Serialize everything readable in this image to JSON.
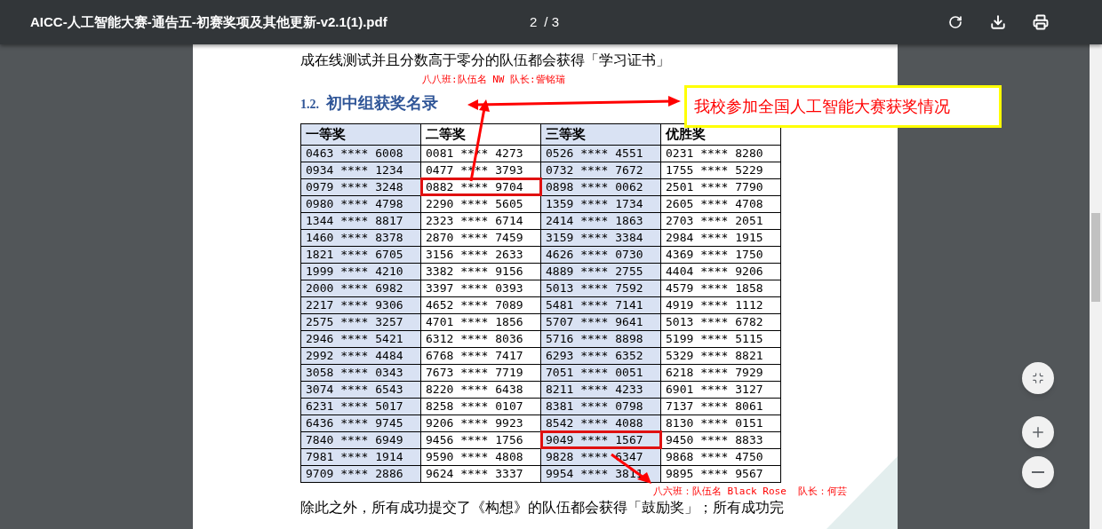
{
  "toolbar": {
    "title": "AICC-人工智能大赛-通告五-初赛奖项及其他更新-v2.1(1).pdf",
    "current_page": "2",
    "page_total": "/ 3"
  },
  "document": {
    "intro_line": "成在线测试并且分数高于零分的队伍都会获得「学习证书」",
    "section_number": "1.2.",
    "section_title": "初中组获奖名录",
    "table": {
      "columns": [
        "一等奖",
        "二等奖",
        "三等奖",
        "优胜奖"
      ],
      "rows": [
        [
          {
            "text": "0463 **** 6008",
            "highlighted": false
          },
          {
            "text": "0081 **** 4273",
            "highlighted": false
          },
          {
            "text": "0526 **** 4551",
            "highlighted": false
          },
          {
            "text": "0231 **** 8280",
            "highlighted": false
          }
        ],
        [
          {
            "text": "0934 **** 1234",
            "highlighted": false
          },
          {
            "text": "0477 **** 3793",
            "highlighted": false
          },
          {
            "text": "0732 **** 7672",
            "highlighted": false
          },
          {
            "text": "1755 **** 5229",
            "highlighted": false
          }
        ],
        [
          {
            "text": "0979 **** 3248",
            "highlighted": false
          },
          {
            "text": "0882 **** 9704",
            "highlighted": true
          },
          {
            "text": "0898 **** 0062",
            "highlighted": false
          },
          {
            "text": "2501 **** 7790",
            "highlighted": false
          }
        ],
        [
          {
            "text": "0980 **** 4798",
            "highlighted": false
          },
          {
            "text": "2290 **** 5605",
            "highlighted": false
          },
          {
            "text": "1359 **** 1734",
            "highlighted": false
          },
          {
            "text": "2605 **** 4708",
            "highlighted": false
          }
        ],
        [
          {
            "text": "1344 **** 8817",
            "highlighted": false
          },
          {
            "text": "2323 **** 6714",
            "highlighted": false
          },
          {
            "text": "2414 **** 1863",
            "highlighted": false
          },
          {
            "text": "2703 **** 2051",
            "highlighted": false
          }
        ],
        [
          {
            "text": "1460 **** 8378",
            "highlighted": false
          },
          {
            "text": "2870 **** 7459",
            "highlighted": false
          },
          {
            "text": "3159 **** 3384",
            "highlighted": false
          },
          {
            "text": "2984 **** 1915",
            "highlighted": false
          }
        ],
        [
          {
            "text": "1821 **** 6705",
            "highlighted": false
          },
          {
            "text": "3156 **** 2633",
            "highlighted": false
          },
          {
            "text": "4626 **** 0730",
            "highlighted": false
          },
          {
            "text": "4369 **** 1750",
            "highlighted": false
          }
        ],
        [
          {
            "text": "1999 **** 4210",
            "highlighted": false
          },
          {
            "text": "3382 **** 9156",
            "highlighted": false
          },
          {
            "text": "4889 **** 2755",
            "highlighted": false
          },
          {
            "text": "4404 **** 9206",
            "highlighted": false
          }
        ],
        [
          {
            "text": "2000 **** 6982",
            "highlighted": false
          },
          {
            "text": "3397 **** 0393",
            "highlighted": false
          },
          {
            "text": "5013 **** 7592",
            "highlighted": false
          },
          {
            "text": "4579 **** 1858",
            "highlighted": false
          }
        ],
        [
          {
            "text": "2217 **** 9306",
            "highlighted": false
          },
          {
            "text": "4652 **** 7089",
            "highlighted": false
          },
          {
            "text": "5481 **** 7141",
            "highlighted": false
          },
          {
            "text": "4919 **** 1112",
            "highlighted": false
          }
        ],
        [
          {
            "text": "2575 **** 3257",
            "highlighted": false
          },
          {
            "text": "4701 **** 1856",
            "highlighted": false
          },
          {
            "text": "5707 **** 9641",
            "highlighted": false
          },
          {
            "text": "5013 **** 6782",
            "highlighted": false
          }
        ],
        [
          {
            "text": "2946 **** 5421",
            "highlighted": false
          },
          {
            "text": "6312 **** 8036",
            "highlighted": false
          },
          {
            "text": "5716 **** 8898",
            "highlighted": false
          },
          {
            "text": "5199 **** 5115",
            "highlighted": false
          }
        ],
        [
          {
            "text": "2992 **** 4484",
            "highlighted": false
          },
          {
            "text": "6768 **** 7417",
            "highlighted": false
          },
          {
            "text": "6293 **** 6352",
            "highlighted": false
          },
          {
            "text": "5329 **** 8821",
            "highlighted": false
          }
        ],
        [
          {
            "text": "3058 **** 0343",
            "highlighted": false
          },
          {
            "text": "7673 **** 7719",
            "highlighted": false
          },
          {
            "text": "7051 **** 0051",
            "highlighted": false
          },
          {
            "text": "6218 **** 7929",
            "highlighted": false
          }
        ],
        [
          {
            "text": "3074 **** 6543",
            "highlighted": false
          },
          {
            "text": "8220 **** 6438",
            "highlighted": false
          },
          {
            "text": "8211 **** 4233",
            "highlighted": false
          },
          {
            "text": "6901 **** 3127",
            "highlighted": false
          }
        ],
        [
          {
            "text": "6231 **** 5017",
            "highlighted": false
          },
          {
            "text": "8258 **** 0107",
            "highlighted": false
          },
          {
            "text": "8381 **** 0798",
            "highlighted": false
          },
          {
            "text": "7137 **** 8061",
            "highlighted": false
          }
        ],
        [
          {
            "text": "6436 **** 9745",
            "highlighted": false
          },
          {
            "text": "9206 **** 9923",
            "highlighted": false
          },
          {
            "text": "8542 **** 4088",
            "highlighted": false
          },
          {
            "text": "8130 **** 0151",
            "highlighted": false
          }
        ],
        [
          {
            "text": "7840 **** 6949",
            "highlighted": false
          },
          {
            "text": "9456 **** 1756",
            "highlighted": false
          },
          {
            "text": "9049 **** 1567",
            "highlighted": true
          },
          {
            "text": "9450 **** 8833",
            "highlighted": false
          }
        ],
        [
          {
            "text": "7981 **** 1914",
            "highlighted": false
          },
          {
            "text": "9590 **** 4808",
            "highlighted": false
          },
          {
            "text": "9828 **** 6347",
            "highlighted": false
          },
          {
            "text": "9868 **** 4750",
            "highlighted": false
          }
        ],
        [
          {
            "text": "9709 **** 2886",
            "highlighted": false
          },
          {
            "text": "9624 **** 3337",
            "highlighted": false
          },
          {
            "text": "9954 **** 3811",
            "highlighted": false
          },
          {
            "text": "9895 **** 9567",
            "highlighted": false
          }
        ]
      ]
    },
    "closing_line": "除此之外，所有成功提交了《构想》的队伍都会获得「鼓励奖」；所有成功完"
  },
  "annotations": {
    "team_note_top": "八八班:队伍名 NW 队长:訾铭瑞",
    "callout": "我校参加全国人工智能大赛获奖情况",
    "team_note_bottom": "八六班：队伍名 Black Rose  队长：何芸"
  }
}
